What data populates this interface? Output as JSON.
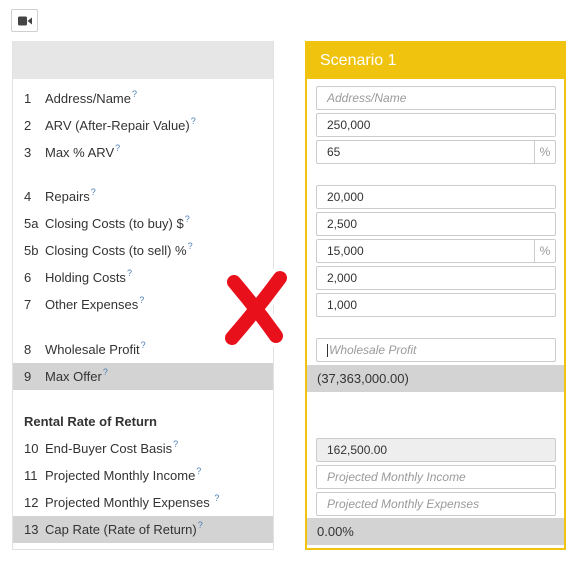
{
  "toolbar": {
    "video_icon": "video-camera-icon"
  },
  "labels": {
    "rows": [
      {
        "num": "1",
        "label": "Address/Name"
      },
      {
        "num": "2",
        "label": "ARV (After-Repair Value)"
      },
      {
        "num": "3",
        "label": "Max % ARV"
      },
      {
        "num": "4",
        "label": "Repairs"
      },
      {
        "num": "5a",
        "label": "Closing Costs (to buy) $"
      },
      {
        "num": "5b",
        "label": "Closing Costs (to sell) %"
      },
      {
        "num": "6",
        "label": "Holding Costs"
      },
      {
        "num": "7",
        "label": "Other Expenses"
      },
      {
        "num": "8",
        "label": "Wholesale Profit"
      },
      {
        "num": "9",
        "label": "Max Offer"
      },
      {
        "num": "10",
        "label": "End-Buyer Cost Basis"
      },
      {
        "num": "11",
        "label": "Projected Monthly Income"
      },
      {
        "num": "12",
        "label": "Projected Monthly Expenses"
      },
      {
        "num": "13",
        "label": "Cap Rate (Rate of Return)"
      }
    ],
    "help_mark": "?",
    "section_rental": "Rental Rate of Return"
  },
  "scenario": {
    "title": "Scenario 1",
    "address_placeholder": "Address/Name",
    "arv": "250,000",
    "max_pct_arv": "65",
    "pct_symbol": "%",
    "repairs": "20,000",
    "closing_buy": "2,500",
    "closing_sell": "15,000",
    "holding": "2,000",
    "other": "1,000",
    "wholesale_placeholder": "Wholesale Profit",
    "max_offer": "(37,363,000.00)",
    "end_buyer_basis": "162,500.00",
    "monthly_income_placeholder": "Projected Monthly Income",
    "monthly_expenses_placeholder": "Projected Monthly Expenses",
    "cap_rate": "0.00%"
  },
  "colors": {
    "accent": "#f0c30f",
    "error_x": "#e8101a"
  }
}
